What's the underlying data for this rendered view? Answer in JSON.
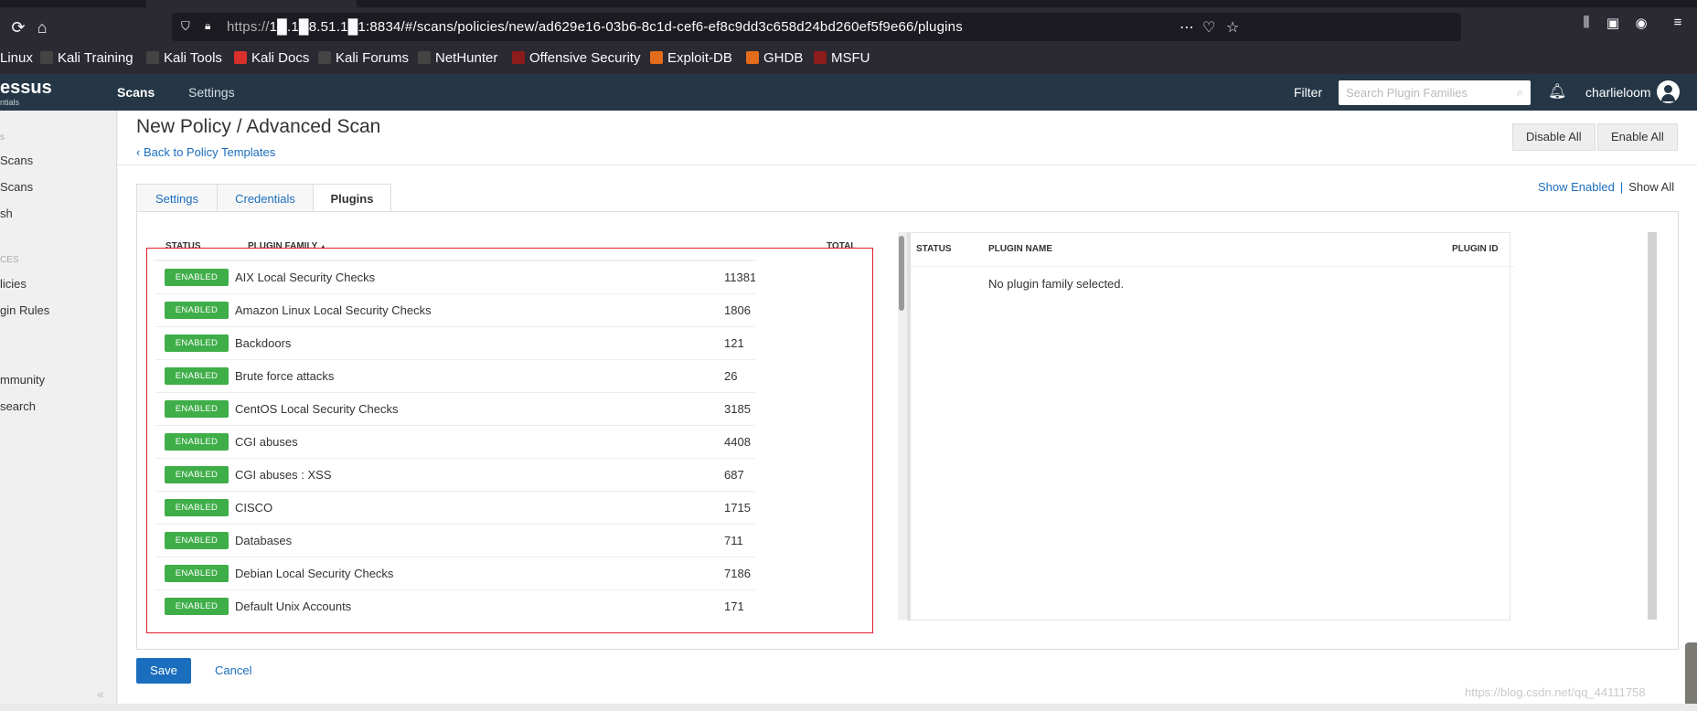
{
  "browser": {
    "url_prefix": "https://",
    "url_host": "1█.1█8.51.1█1",
    "url_rest": ":8834/#/scans/policies/new/ad629e16-03b6-8c1d-cef6-ef8c9dd3c658d24bd260ef5f9e66/plugins",
    "bookmarks": [
      {
        "label": "Linux",
        "icon": "kali-icon",
        "color": "#2b2a33"
      },
      {
        "label": "Kali Training",
        "icon": "kali-icon",
        "color": "#2b2a33"
      },
      {
        "label": "Kali Tools",
        "icon": "kali-icon",
        "color": "#2b2a33"
      },
      {
        "label": "Kali Docs",
        "icon": "kali-docs-icon",
        "color": "#d9302c"
      },
      {
        "label": "Kali Forums",
        "icon": "kali-icon",
        "color": "#2b2a33"
      },
      {
        "label": "NetHunter",
        "icon": "nethunter-icon",
        "color": "#2b2a33"
      },
      {
        "label": "Offensive Security",
        "icon": "offsec-icon",
        "color": "#8c1b1b"
      },
      {
        "label": "Exploit-DB",
        "icon": "exploitdb-icon",
        "color": "#e36c1b"
      },
      {
        "label": "GHDB",
        "icon": "ghdb-icon",
        "color": "#e36c1b"
      },
      {
        "label": "MSFU",
        "icon": "msfu-icon",
        "color": "#8c1b1b"
      }
    ]
  },
  "header": {
    "logo": "essus",
    "logo_sub": "ntials",
    "nav": [
      "Scans",
      "Settings"
    ],
    "filter_label": "Filter",
    "search_placeholder": "Search Plugin Families",
    "user": "charlieloom"
  },
  "sidebar": {
    "items": [
      "s",
      "Scans",
      "Scans",
      "sh",
      "CES",
      "licies",
      "gin Rules",
      "mmunity",
      "search"
    ]
  },
  "page": {
    "title": "New Policy / Advanced Scan",
    "back_link": "Back to Policy Templates",
    "disable_all": "Disable All",
    "enable_all": "Enable All",
    "tabs": [
      "Settings",
      "Credentials",
      "Plugins"
    ],
    "show_enabled": "Show Enabled",
    "separator": "|",
    "show_all": "Show All"
  },
  "families_table": {
    "headers": {
      "status": "STATUS",
      "family": "PLUGIN FAMILY",
      "sort_indicator": "▲",
      "total": "TOTAL"
    },
    "rows": [
      {
        "status": "ENABLED",
        "family": "AIX Local Security Checks",
        "total": "11381"
      },
      {
        "status": "ENABLED",
        "family": "Amazon Linux Local Security Checks",
        "total": "1806"
      },
      {
        "status": "ENABLED",
        "family": "Backdoors",
        "total": "121"
      },
      {
        "status": "ENABLED",
        "family": "Brute force attacks",
        "total": "26"
      },
      {
        "status": "ENABLED",
        "family": "CentOS Local Security Checks",
        "total": "3185"
      },
      {
        "status": "ENABLED",
        "family": "CGI abuses",
        "total": "4408"
      },
      {
        "status": "ENABLED",
        "family": "CGI abuses : XSS",
        "total": "687"
      },
      {
        "status": "ENABLED",
        "family": "CISCO",
        "total": "1715"
      },
      {
        "status": "ENABLED",
        "family": "Databases",
        "total": "711"
      },
      {
        "status": "ENABLED",
        "family": "Debian Local Security Checks",
        "total": "7186"
      },
      {
        "status": "ENABLED",
        "family": "Default Unix Accounts",
        "total": "171"
      }
    ]
  },
  "plugins_table": {
    "headers": {
      "status": "STATUS",
      "name": "PLUGIN NAME",
      "id": "PLUGIN ID"
    },
    "empty_text": "No plugin family selected."
  },
  "footer": {
    "save": "Save",
    "cancel": "Cancel",
    "watermark": "https://blog.csdn.net/qq_44111758"
  },
  "colors": {
    "header_bg": "#253746",
    "enabled_badge": "#3fae49",
    "link": "#1b6ebd",
    "annotation_box": "#e11d2b"
  }
}
